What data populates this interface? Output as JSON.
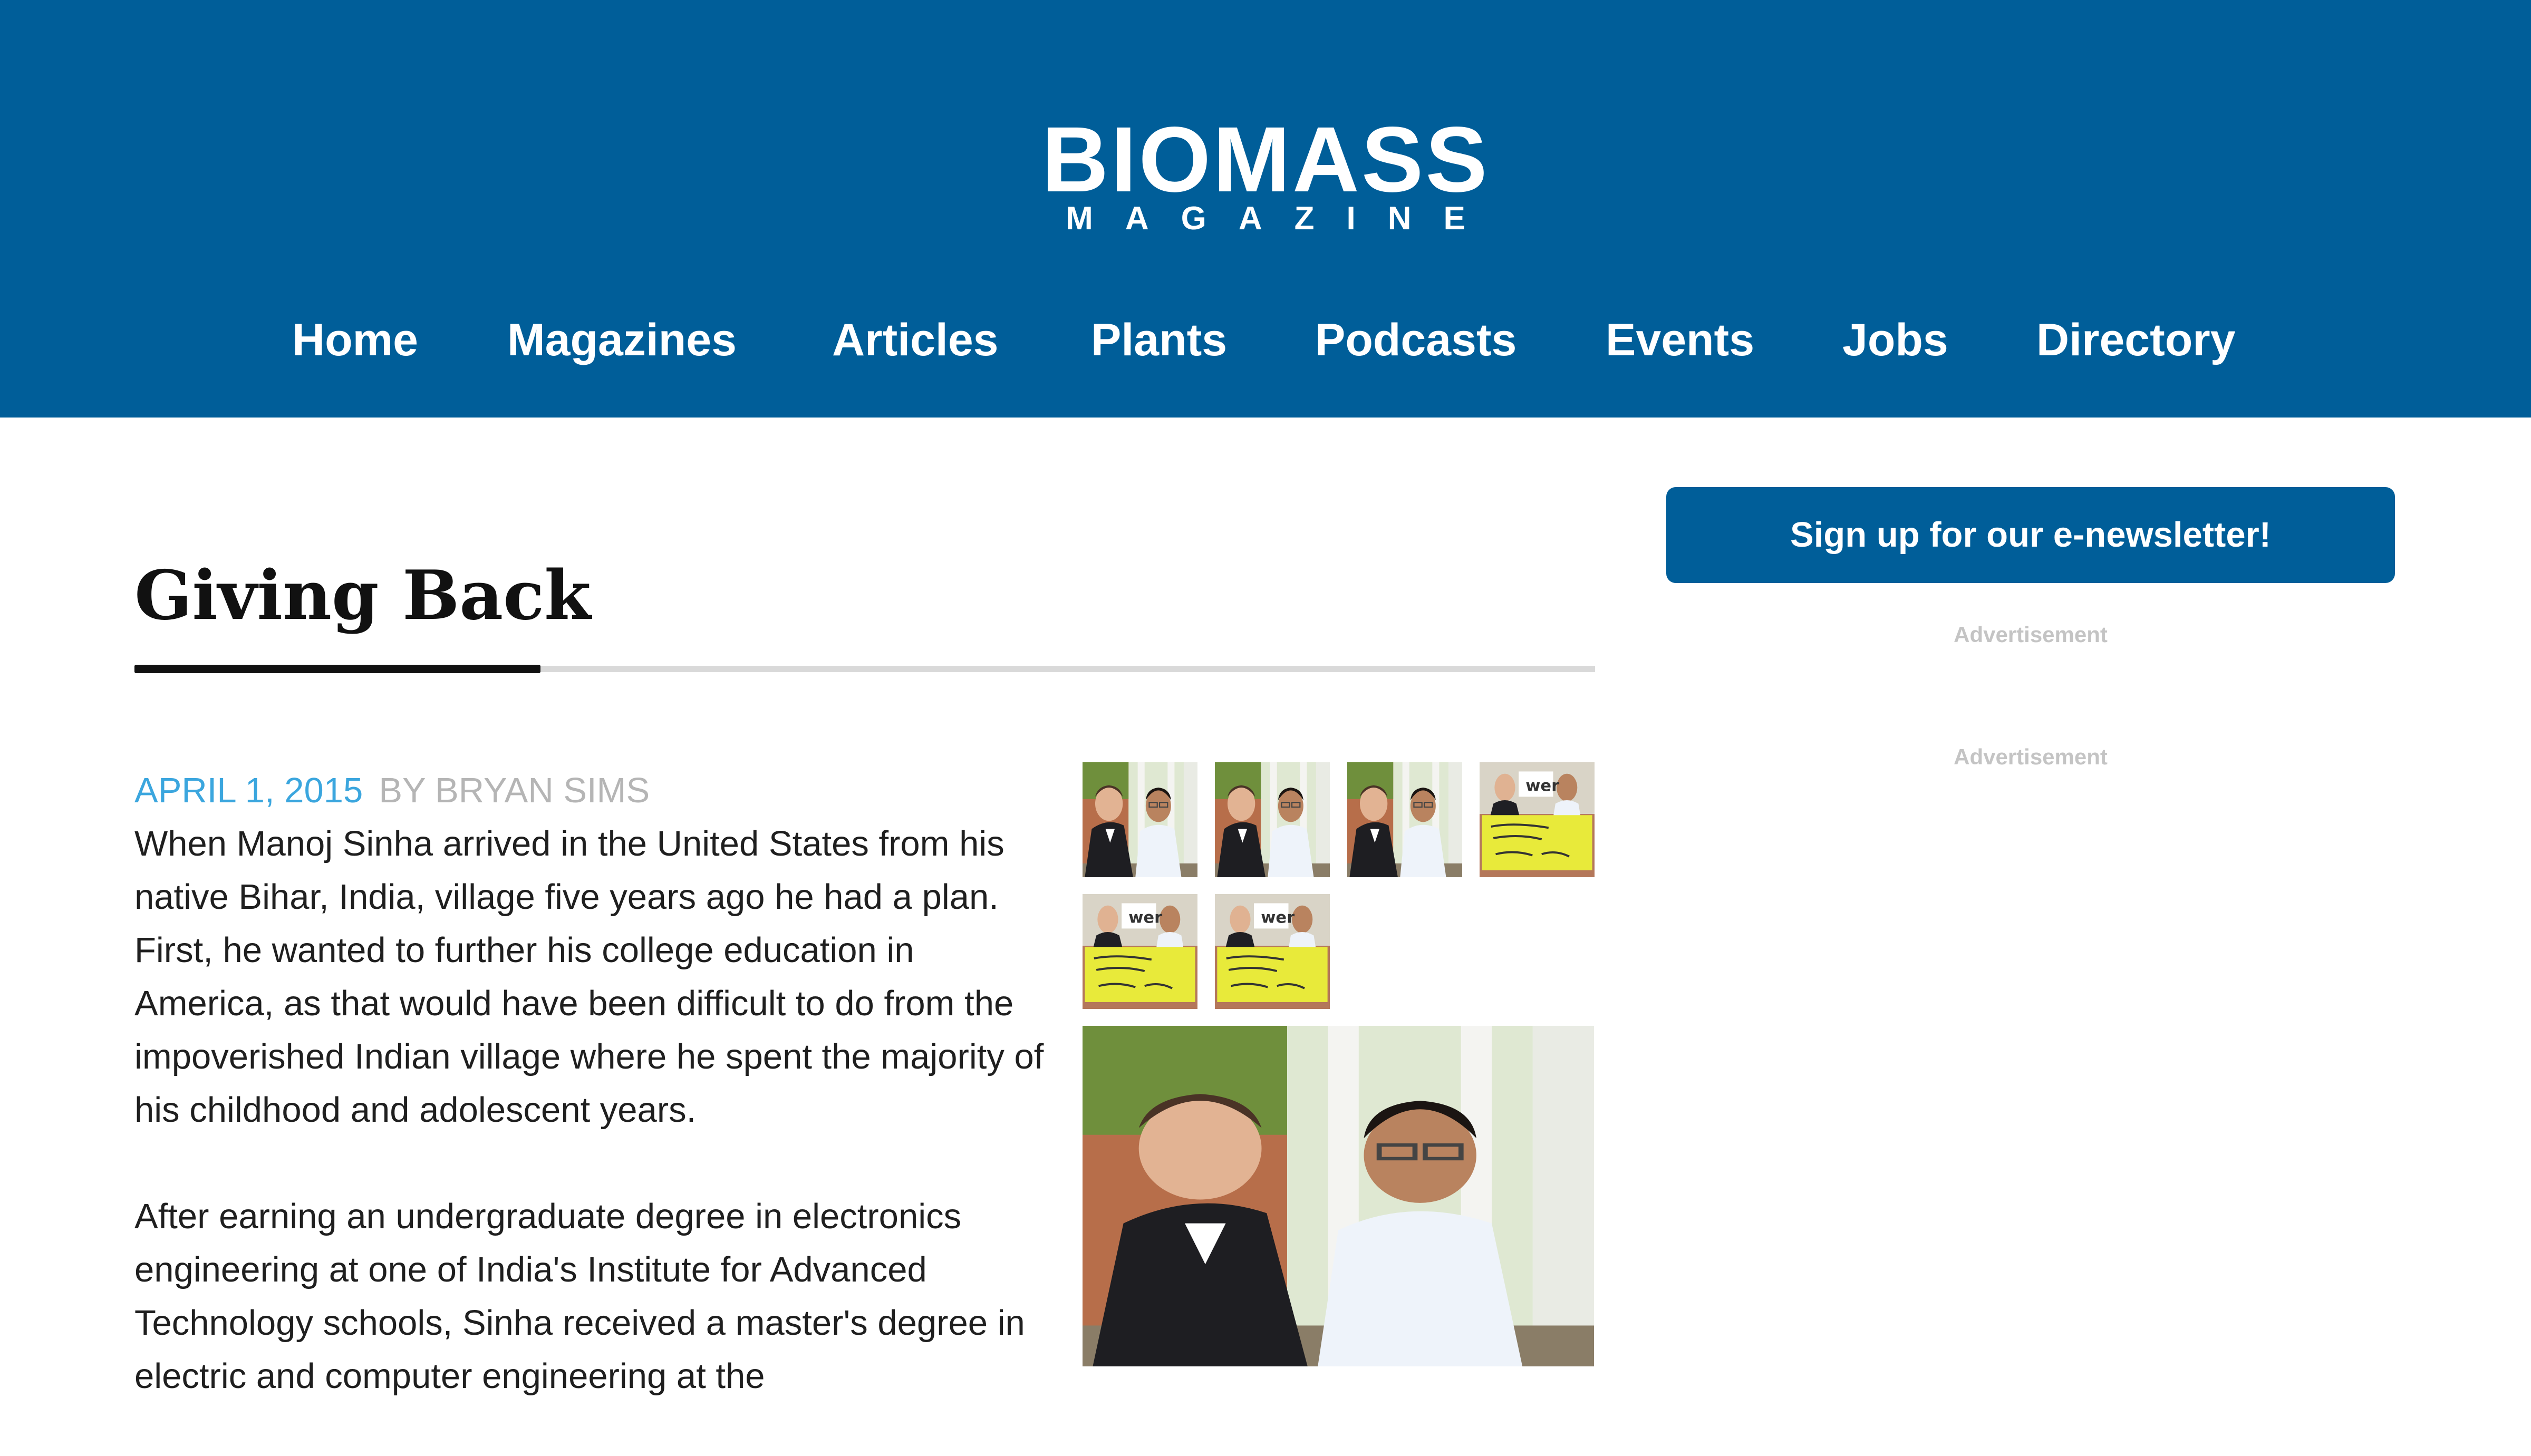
{
  "header": {
    "logo": {
      "main": "BIOMASS",
      "sub": "MAGAZINE"
    },
    "nav": [
      "Home",
      "Magazines",
      "Articles",
      "Plants",
      "Podcasts",
      "Events",
      "Jobs",
      "Directory"
    ]
  },
  "article": {
    "title": "Giving Back",
    "date": "APRIL 1, 2015",
    "author": "BY BRYAN SIMS",
    "paragraphs": [
      "When Manoj Sinha arrived in the United States from his native Bihar, India, village five years ago he had a plan. First, he wanted to further his college education in America, as that would have been difficult to do from the impoverished Indian village where he spent the majority of his childhood and adolescent years.",
      "After earning an undergraduate degree in electronics engineering at one of India's Institute for Advanced Technology schools, Sinha received a master's degree in electric and computer engineering at the"
    ]
  },
  "gallery": {
    "thumbnails": [
      "portrait",
      "portrait",
      "portrait",
      "check",
      "check",
      "check"
    ],
    "main_image": "portrait"
  },
  "sidebar": {
    "newsletter_label": "Sign up for our e-newsletter!",
    "ads": [
      "Advertisement",
      "Advertisement"
    ]
  },
  "colors": {
    "brand": "#005e99",
    "date": "#3ba6de",
    "author": "#b5b5b5"
  }
}
